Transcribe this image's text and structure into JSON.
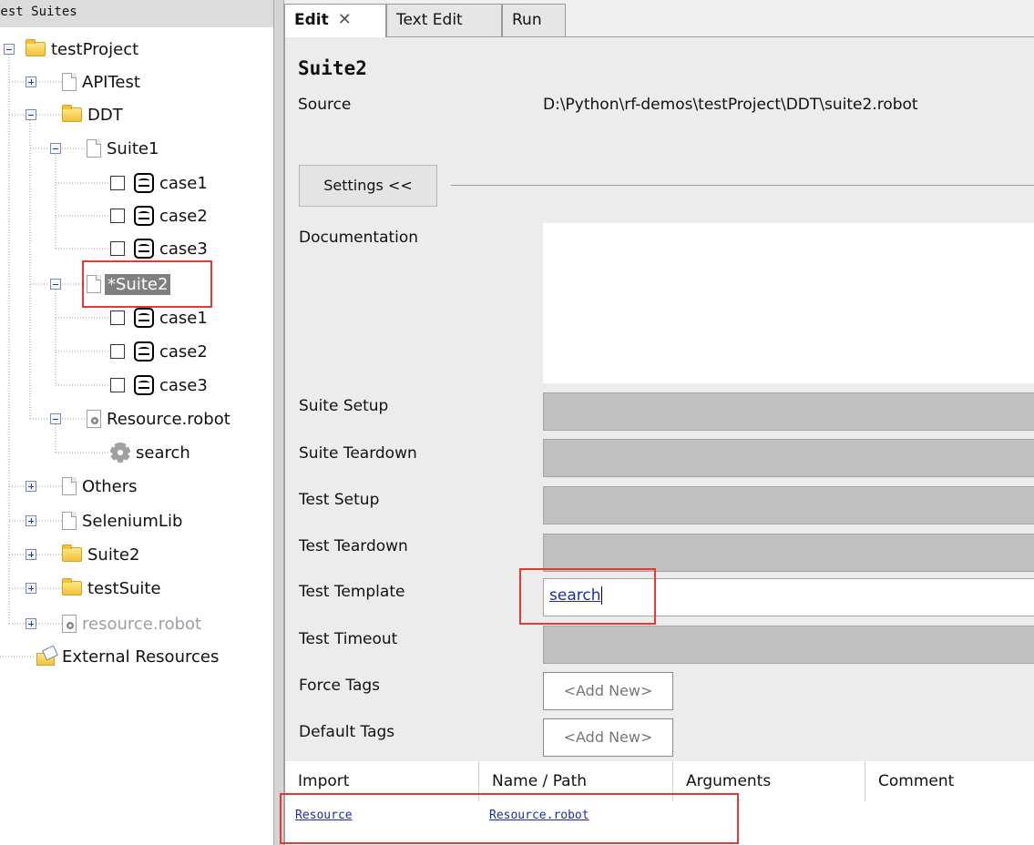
{
  "tree": {
    "header": "Test Suites",
    "nodes": [
      {
        "label": "testProject"
      },
      {
        "label": "APITest"
      },
      {
        "label": "DDT"
      },
      {
        "label": "Suite1"
      },
      {
        "label": "case1"
      },
      {
        "label": "case2"
      },
      {
        "label": "case3"
      },
      {
        "label": "*Suite2"
      },
      {
        "label": "case1"
      },
      {
        "label": "case2"
      },
      {
        "label": "case3"
      },
      {
        "label": "Resource.robot"
      },
      {
        "label": "search"
      },
      {
        "label": "Others"
      },
      {
        "label": "SeleniumLib"
      },
      {
        "label": "Suite2"
      },
      {
        "label": "testSuite"
      },
      {
        "label": "resource.robot"
      },
      {
        "label": "External Resources"
      }
    ]
  },
  "tabs": [
    {
      "label": "Edit",
      "close": "✕"
    },
    {
      "label": "Text Edit"
    },
    {
      "label": "Run"
    }
  ],
  "editor": {
    "suite_name": "Suite2",
    "source_label": "Source",
    "source_path": "D:\\Python\\rf-demos\\testProject\\DDT\\suite2.robot",
    "settings_button": "Settings <<",
    "fields": {
      "documentation": "Documentation",
      "suite_setup": "Suite Setup",
      "suite_teardown": "Suite Teardown",
      "test_setup": "Test Setup",
      "test_teardown": "Test Teardown",
      "test_template": "Test Template",
      "test_timeout": "Test Timeout",
      "force_tags": "Force Tags",
      "default_tags": "Default Tags"
    },
    "test_template_value": "search",
    "add_new": "<Add New>"
  },
  "import_table": {
    "columns": [
      "Import",
      "Name / Path",
      "Arguments",
      "Comment"
    ],
    "rows": [
      {
        "import": "Resource",
        "name_path": "Resource.robot"
      }
    ]
  },
  "colors": {
    "highlight_box": "#e53935",
    "link": "#1a2ea8",
    "selected": "#808080"
  }
}
